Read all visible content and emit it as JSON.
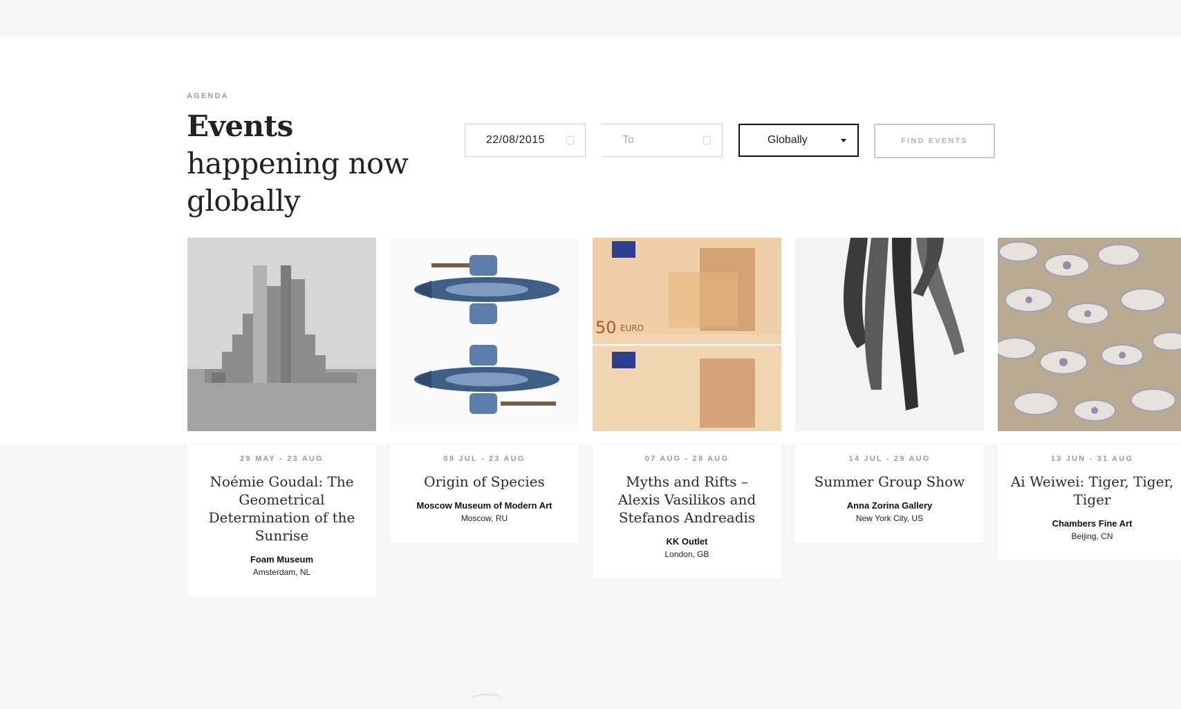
{
  "section": {
    "eyebrow": "AGENDA",
    "headline_bold": "Events",
    "headline_rest": " happening now globally"
  },
  "filters": {
    "from_value": "22/08/2015",
    "to_placeholder": "To",
    "location": "Globally",
    "find_label": "FIND EVENTS"
  },
  "events": [
    {
      "date": "29 MAY - 23 AUG",
      "title": "Noémie Goudal: The Geometrical Determination of the Sunrise",
      "venue": "Foam Museum",
      "location": "Amsterdam, NL"
    },
    {
      "date": "09 JUL - 23 AUG",
      "title": "Origin of Species",
      "venue": "Moscow Museum of Modern Art",
      "location": "Moscow, RU"
    },
    {
      "date": "07 AUG - 28 AUG",
      "title": "Myths and Rifts – Alexis Vasilikos and Stefanos Andreadis",
      "venue": "KK Outlet",
      "location": "London, GB"
    },
    {
      "date": "14 JUL - 29 AUG",
      "title": "Summer Group Show",
      "venue": "Anna Zorina Gallery",
      "location": "New York City, US"
    },
    {
      "date": "13 JUN - 31 AUG",
      "title": "Ai Weiwei: Tiger, Tiger, Tiger",
      "venue": "Chambers Fine Art",
      "location": "Beijing, CN"
    }
  ],
  "banknote": {
    "value": "50",
    "currency": "EURO"
  }
}
